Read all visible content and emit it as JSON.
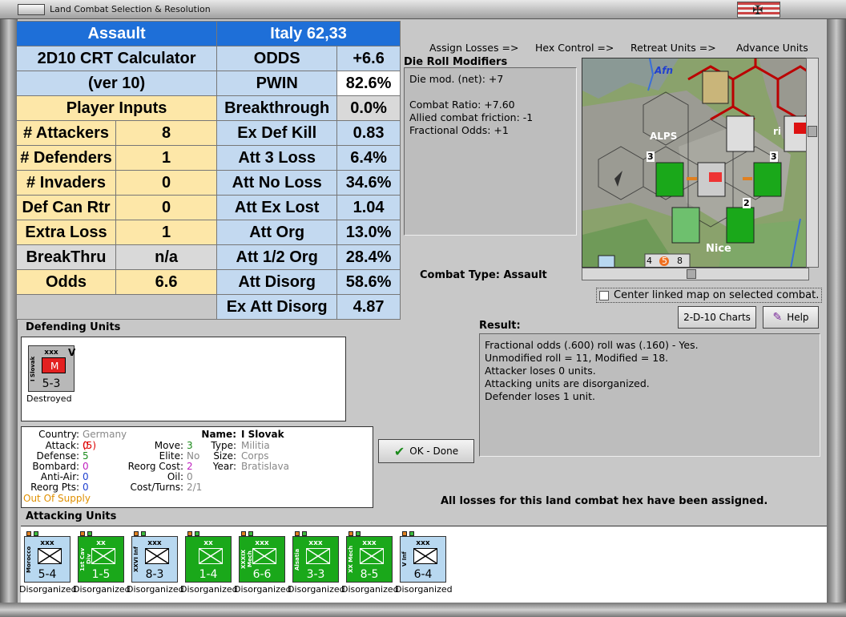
{
  "window": {
    "title": "Land Combat Selection & Resolution"
  },
  "crt": {
    "header_left": "Assault",
    "header_right": "Italy 62,33",
    "calc_title_1": "2D10 CRT Calculator",
    "calc_title_2": "(ver 10)",
    "player_inputs": "Player Inputs",
    "inputs": [
      {
        "label": "# Attackers",
        "value": "8"
      },
      {
        "label": "# Defenders",
        "value": "1"
      },
      {
        "label": "# Invaders",
        "value": "0"
      },
      {
        "label": "Def Can Rtr",
        "value": "0"
      },
      {
        "label": "Extra Loss",
        "value": "1"
      },
      {
        "label": "BreakThru",
        "value": "n/a"
      },
      {
        "label": "Odds",
        "value": "6.6"
      }
    ],
    "outputs": [
      {
        "label": "ODDS",
        "value": "+6.6"
      },
      {
        "label": "PWIN",
        "value": "82.6%"
      },
      {
        "label": "Breakthrough",
        "value": "0.0%"
      },
      {
        "label": "Ex Def Kill",
        "value": "0.83"
      },
      {
        "label": "Att 3 Loss",
        "value": "6.4%"
      },
      {
        "label": "Att No Loss",
        "value": "34.6%"
      },
      {
        "label": "Att Ex Lost",
        "value": "1.04"
      },
      {
        "label": "Att Org",
        "value": "13.0%"
      },
      {
        "label": "Att 1/2 Org",
        "value": "28.4%"
      },
      {
        "label": "Att Disorg",
        "value": "58.6%"
      },
      {
        "label": "Ex Att Disorg",
        "value": "4.87"
      }
    ]
  },
  "steps": [
    "Assign Losses =>",
    "Hex Control =>",
    "Retreat Units =>",
    "Advance Units"
  ],
  "die_roll": {
    "title": "Die Roll Modifiers",
    "lines": [
      "Die mod. (net): +7",
      "",
      "Combat Ratio: +7.60",
      "Allied combat friction: -1",
      "Fractional Odds: +1"
    ]
  },
  "combat_type": {
    "label": "Combat Type:",
    "value": "Assault"
  },
  "map": {
    "labels": {
      "afn": "Afn",
      "alps": "ALPS",
      "nice": "Nice",
      "stack_a": "4",
      "stack_b": "5",
      "stack_c": "8",
      "stack_num_3a": "3",
      "stack_num_3b": "3",
      "stack_num_2": "2",
      "edge_r": "ri"
    }
  },
  "center_map": "Center linked map on selected combat.",
  "buttons": {
    "charts": "2-D-10 Charts",
    "help": "Help",
    "ok": "OK - Done"
  },
  "result": {
    "title": "Result:",
    "lines": [
      "Fractional odds (.600) roll was (.160)  - Yes.",
      "Unmodified roll = 11, Modified = 18.",
      "Attacker loses 0 units.",
      "Attacking units are disorganized.",
      "Defender loses 1 unit."
    ]
  },
  "defending": {
    "title": "Defending Units",
    "unit": {
      "size": "xxx",
      "name": "I Slovak",
      "value": "5-3",
      "marker": "V",
      "status": "Destroyed"
    }
  },
  "unit_info": {
    "country_label": "Country:",
    "country": "Germany",
    "attack_label": "Attack:",
    "attack": "0",
    "attack_paren": "(5)",
    "defense_label": "Defense:",
    "defense": "5",
    "bombard_label": "Bombard:",
    "bombard": "0",
    "antiair_label": "Anti-Air:",
    "antiair": "0",
    "reorg_label": "Reorg Pts:",
    "reorg": "0",
    "supply": "Out Of Supply",
    "move_label": "Move:",
    "move": "3",
    "elite_label": "Elite:",
    "elite": "No",
    "reorgcost_label": "Reorg Cost:",
    "reorgcost": "2",
    "oil_label": "Oil:",
    "oil": "0",
    "cost_label": "Cost/Turns:",
    "cost": "2/1",
    "name_label": "Name:",
    "name": "I Slovak",
    "type_label": "Type:",
    "type": "Militia",
    "size_label": "Size:",
    "size": "Corps",
    "year_label": "Year:",
    "year": "Bratislava"
  },
  "all_losses": "All losses for this land combat hex have been assigned.",
  "attacking": {
    "title": "Attacking Units",
    "units": [
      {
        "size": "xxx",
        "name": "Morocco",
        "value": "5-4",
        "status": "Disorganized",
        "color": "#b8d8f0"
      },
      {
        "size": "xx",
        "name": "1st Cav Div",
        "value": "1-5",
        "status": "Disorganized",
        "color": "#1aa81a"
      },
      {
        "size": "xxx",
        "name": "XXVI Inf",
        "value": "8-3",
        "status": "Disorganized",
        "color": "#b8d8f0"
      },
      {
        "size": "xx",
        "name": "",
        "value": "1-4",
        "status": "Disorganized",
        "color": "#1aa81a"
      },
      {
        "size": "xxx",
        "name": "XXXIX Mech",
        "value": "6-6",
        "status": "Disorganized",
        "color": "#1aa81a"
      },
      {
        "size": "xxx",
        "name": "Alsatia",
        "value": "3-3",
        "status": "Disorganized",
        "color": "#1aa81a"
      },
      {
        "size": "xxx",
        "name": "XX Mech",
        "value": "8-5",
        "status": "Disorganized",
        "color": "#1aa81a"
      },
      {
        "size": "xxx",
        "name": "V Inf",
        "value": "6-4",
        "status": "Disorganized",
        "color": "#b8d8f0"
      }
    ]
  }
}
